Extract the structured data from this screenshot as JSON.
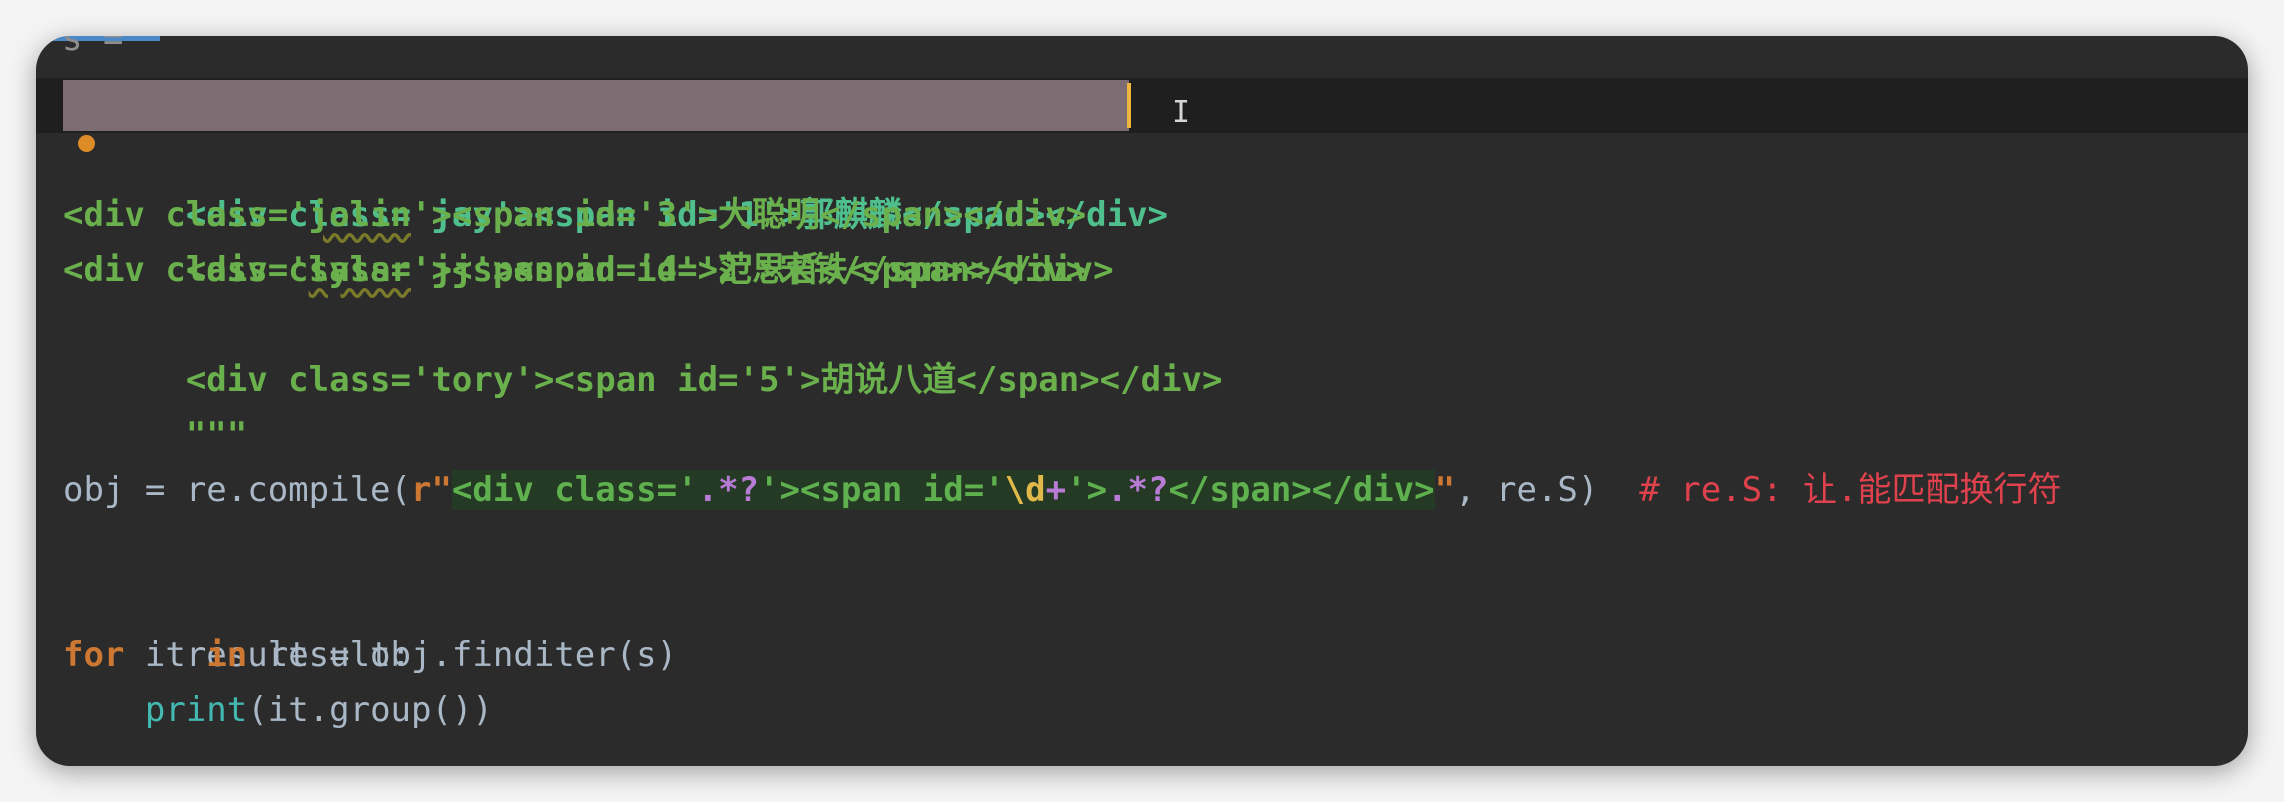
{
  "editor": {
    "partial_top_line": "s =",
    "lines": {
      "l1": "<div class='jay'><span id='1'>郭麒麟</span></div>",
      "l2": "<div class='jj'><span id='2'>宋铁</span></div>",
      "l3a": "<div class='",
      "l3b": "jolin",
      "l3c": "'><span id='3'>大聪明</span></div>",
      "l4a": "<div class='",
      "l4b": "sylar",
      "l4c": "'><span id='4'>范思哲</span></div>",
      "l5": "<div class='tory'><span id='5'>胡说八道</span></div>",
      "l6": "\"\"\"",
      "l8_obj": "obj = re.compile(",
      "l8_r": "r\"",
      "l8_p1": "<div class='",
      "l8_m1": ".*?",
      "l8_p2": "'><span id='",
      "l8_e1": "\\d",
      "l8_m2": "+",
      "l8_p3": "'>",
      "l8_m3": ".*?",
      "l8_p4": "</span></div>",
      "l8_q": "\"",
      "l8_rest": ", re.S)  ",
      "l8_comment": "# re.S: 让.能匹配换行符",
      "l10": "result = obj.finditer(s)",
      "l11_for": "for",
      "l11_it": " it ",
      "l11_in": "in",
      "l11_rest": " result:",
      "l12_indent": "    ",
      "l12_fn": "print",
      "l12_rest": "(it.group())"
    }
  },
  "colors": {
    "background": "#2b2b2b",
    "string": "#6ab04c",
    "keyword": "#cc7832",
    "comment": "#e0424d",
    "builtin": "#43b9b1",
    "selection": "#8e7a80",
    "caret": "#f0b53a"
  },
  "icons": {
    "bookmark": "bookmark-dot-icon",
    "cursor": "text-cursor-icon"
  }
}
